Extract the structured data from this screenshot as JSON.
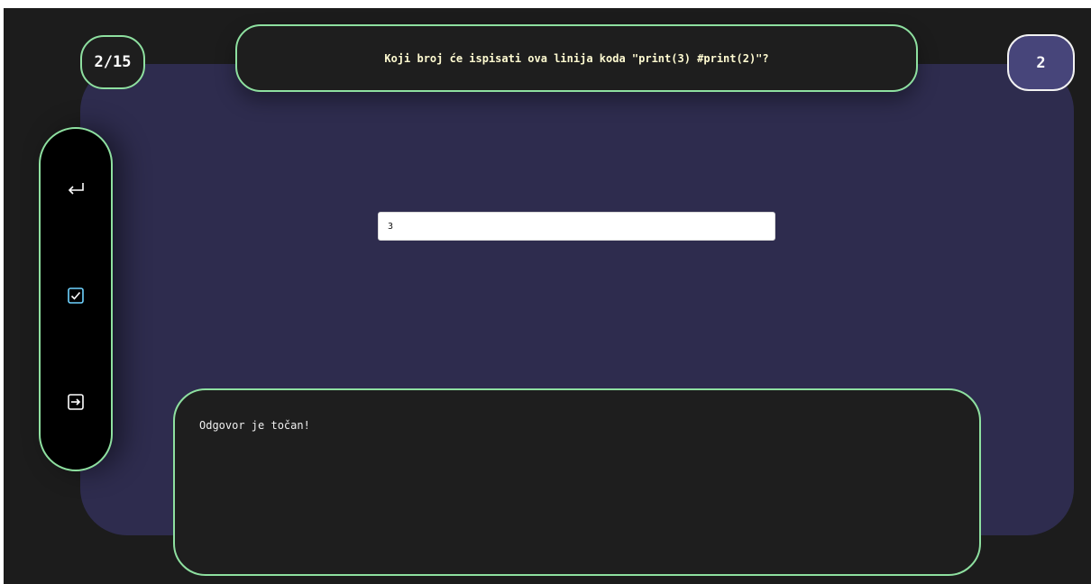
{
  "header": {
    "counter": "2/15",
    "question": "Koji broj će ispisati ova linija koda \"print(3) #print(2)\"?",
    "score": "2"
  },
  "sidebar": {
    "buttons": [
      {
        "icon": "return-arrow-icon"
      },
      {
        "icon": "checkbox-check-icon"
      },
      {
        "icon": "exit-arrow-icon"
      }
    ]
  },
  "answer": {
    "value": "3"
  },
  "feedback": {
    "text": "Odgovor je točan!"
  },
  "colors": {
    "background": "#1c1c1c",
    "panel": "#2e2c4e",
    "accent_border": "#8ee0a0",
    "question_text": "#fffbd1",
    "score_bg": "#47457a"
  }
}
